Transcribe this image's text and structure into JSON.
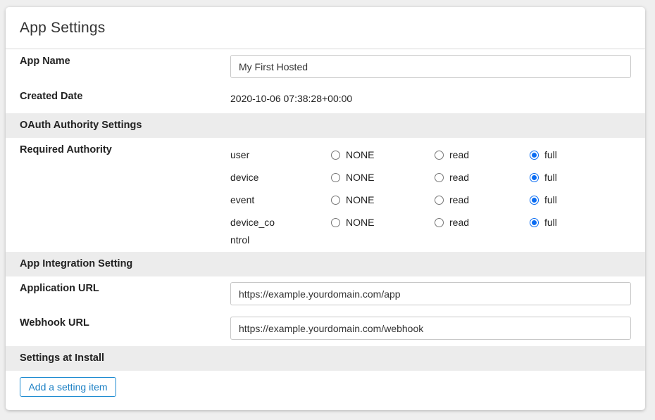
{
  "card": {
    "title": "App Settings"
  },
  "app_name": {
    "label": "App Name",
    "value": "My First Hosted"
  },
  "created_date": {
    "label": "Created Date",
    "value": "2020-10-06 07:38:28+00:00"
  },
  "oauth": {
    "section_title": "OAuth Authority Settings",
    "required_label": "Required Authority",
    "option_labels": [
      "NONE",
      "read",
      "full"
    ],
    "scopes": [
      {
        "name": "user",
        "selected": "full"
      },
      {
        "name": "device",
        "selected": "full"
      },
      {
        "name": "event",
        "selected": "full"
      },
      {
        "name": "device_control",
        "selected": "full"
      }
    ]
  },
  "integration": {
    "section_title": "App Integration Setting",
    "application_url_label": "Application URL",
    "application_url_value": "https://example.yourdomain.com/app",
    "webhook_url_label": "Webhook URL",
    "webhook_url_value": "https://example.yourdomain.com/webhook"
  },
  "install": {
    "section_title": "Settings at Install",
    "add_button_label": "Add a setting item"
  },
  "colors": {
    "accent": "#0a6cf2",
    "button_border": "#1c8ad0",
    "section_band": "#ececec",
    "page_background": "#efefef"
  }
}
